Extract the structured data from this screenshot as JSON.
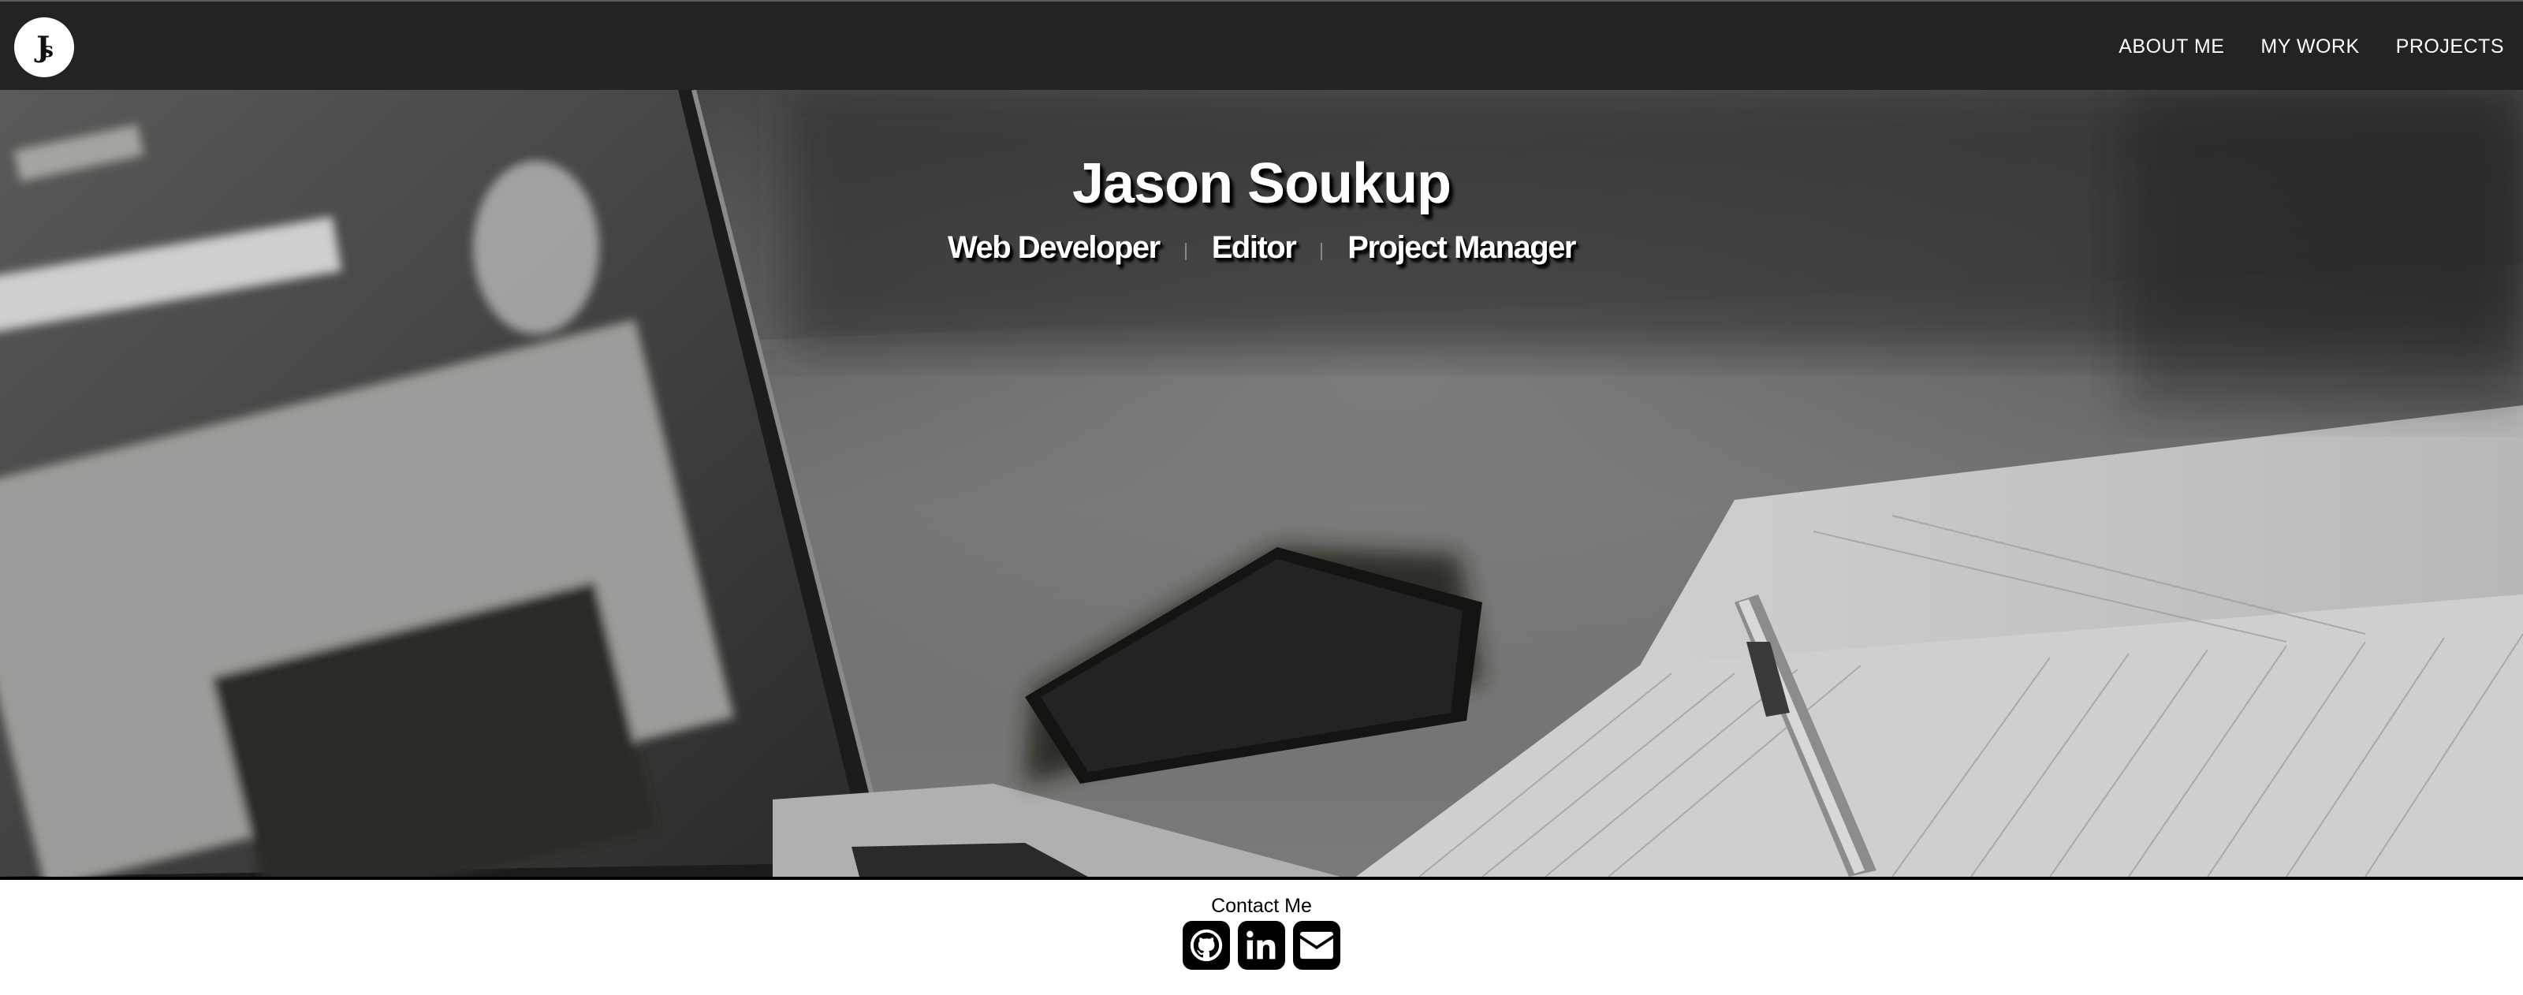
{
  "header": {
    "logo_text": "JS",
    "nav": [
      {
        "label": "ABOUT ME"
      },
      {
        "label": "MY WORK"
      },
      {
        "label": "PROJECTS"
      }
    ]
  },
  "hero": {
    "name": "Jason Soukup",
    "roles": [
      "Web Developer",
      "Editor",
      "Project Manager"
    ],
    "background_image": "grayscale desk with laptop, smartphone, notebook and pen"
  },
  "contact": {
    "title": "Contact Me",
    "icons": [
      "github-icon",
      "linkedin-icon",
      "mail-icon"
    ]
  },
  "colors": {
    "navbar_bg": "#232323",
    "text_light": "#ffffff",
    "contact_icon_bg": "#000000"
  }
}
